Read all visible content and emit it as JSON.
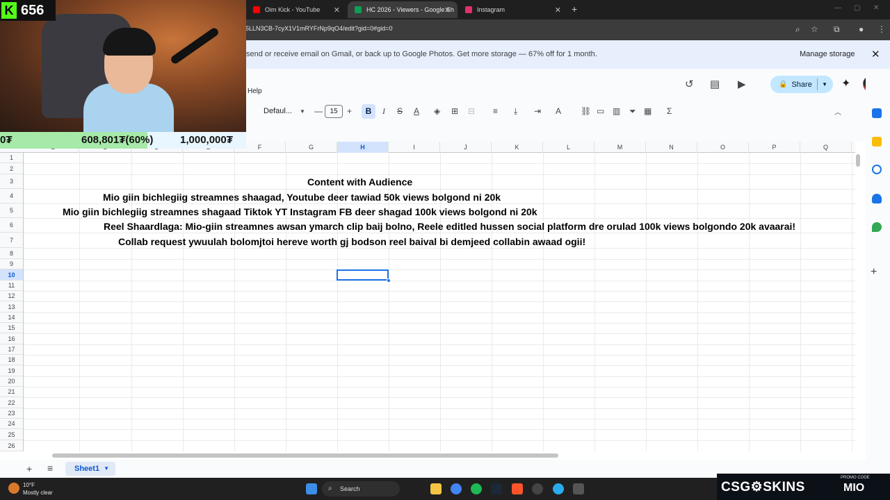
{
  "browser": {
    "tabs": [
      {
        "label": "Oim Kick - YouTube",
        "color": "#ff0000"
      },
      {
        "label": "HC 2026 - Viewers - Google Sh",
        "color": "#0f9d58"
      },
      {
        "label": "Instagram",
        "color": "#e1306c"
      }
    ],
    "url": "5LLN3CB-7cyX1V1mRYFrNp9qO4/edit?gid=0#gid=0"
  },
  "banner": {
    "text": "send or receive email on Gmail, or back up to Google Photos. Get more storage — 67% off for 1 month.",
    "action": "Manage storage"
  },
  "menu": {
    "help": "Help"
  },
  "header": {
    "share_label": "Share"
  },
  "toolbar": {
    "font_name": "Defaul...",
    "font_size": "15",
    "bold": "B"
  },
  "columns": [
    "B",
    "C",
    "D",
    "E",
    "F",
    "G",
    "H",
    "I",
    "J",
    "K",
    "L",
    "M",
    "N",
    "O",
    "P",
    "Q"
  ],
  "rows": [
    "1",
    "2",
    "3",
    "4",
    "5",
    "6",
    "7",
    "8",
    "9",
    "10",
    "11",
    "12",
    "13",
    "14",
    "15",
    "16",
    "17",
    "18",
    "19",
    "20",
    "21",
    "22",
    "23",
    "24",
    "25",
    "26"
  ],
  "cells": {
    "r3": "Content with Audience",
    "r4": "Mio giin bichlegiig streamnes shaagad, Youtube deer tawiad 50k views bolgond ni 20k",
    "r5": "Mio giin bichlegiig streamnes shagaad Tiktok YT Instagram FB deer shagad 100k views bolgond ni 20k",
    "r6": "Reel Shaardlaga: Mio-giin streamnes awsan ymarch clip baij bolno, Reele editled hussen social platform dre orulad 100k views bolgondo 20k avaarai!",
    "r7": "Collab request ywuulah bolomjtoi hereve worth gj bodson reel baival bi demjeed collabin awaad ogii!"
  },
  "sheet_tabs": {
    "active": "Sheet1"
  },
  "taskbar": {
    "temp": "10°F",
    "weather": "Mostly clear",
    "search": "Search"
  },
  "stream": {
    "viewer_count": "656",
    "goal_left": "0₮",
    "goal_progress": "608,801₮(60%)",
    "goal_target": "1,000,000₮",
    "goal_fraction": 0.6
  },
  "sponsor": {
    "brand": "CSG⚙SKINS",
    "promo_label": "PROMO CODE",
    "promo_code": "MIO"
  }
}
